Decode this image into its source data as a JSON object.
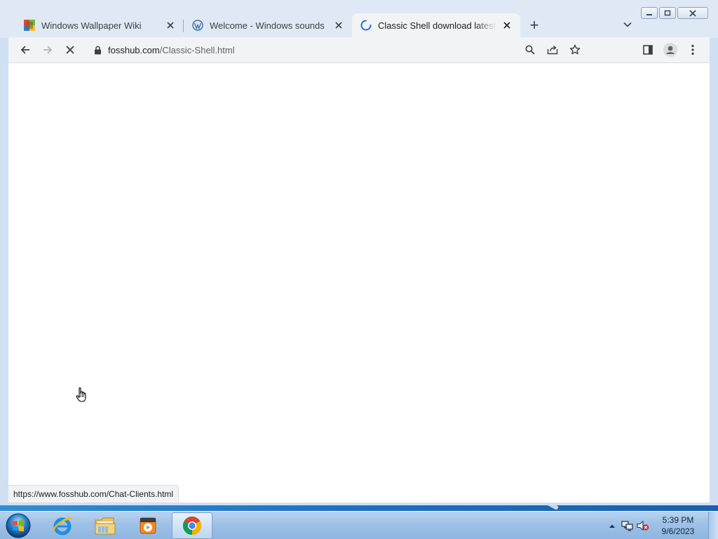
{
  "browser": {
    "tabs": [
      {
        "title": "Windows Wallpaper Wiki",
        "favicon": "wiki-favicon",
        "active": false
      },
      {
        "title": "Welcome - Windows sounds",
        "favicon": "wordpress-favicon",
        "active": false
      },
      {
        "title": "Classic Shell download latest version",
        "favicon": "loading-spinner",
        "active": true
      }
    ],
    "new_tab_label": "+",
    "omnibox": {
      "domain": "fosshub.com",
      "path": "/Classic-Shell.html"
    },
    "status_url": "https://www.fosshub.com/Chat-Clients.html",
    "loading": true
  },
  "taskbar": {
    "apps": [
      {
        "name": "Internet Explorer",
        "icon": "internet-explorer-icon",
        "active": false
      },
      {
        "name": "Windows Explorer",
        "icon": "file-explorer-icon",
        "active": false
      },
      {
        "name": "Windows Media Player",
        "icon": "media-player-icon",
        "active": false
      },
      {
        "name": "Google Chrome",
        "icon": "chrome-icon",
        "active": true
      }
    ],
    "clock": {
      "time": "5:39 PM",
      "date": "9/6/2023"
    }
  },
  "colors": {
    "tab_strip": "#dfe9f6",
    "toolbar": "#f1f3f4",
    "accent_spinner": "#1a73e8",
    "taskbar": "#9ec1e6"
  }
}
